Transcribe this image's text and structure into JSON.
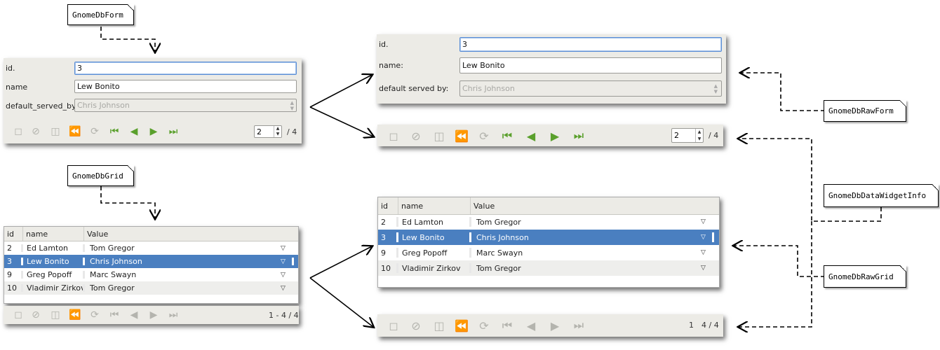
{
  "callouts": {
    "form": "GnomeDbForm",
    "grid": "GnomeDbGrid",
    "raw_form": "GnomeDbRawForm",
    "data_widget_info": "GnomeDbDataWidgetInfo",
    "raw_grid": "GnomeDbRawGrid"
  },
  "small_form": {
    "labels": [
      "id.",
      "name",
      "default_served_by:"
    ],
    "id_value": "3",
    "name_value": "Lew Bonito",
    "served_by_value": "Chris Johnson",
    "spin_value": "2",
    "total": "/ 4"
  },
  "large_form": {
    "labels": [
      "id.",
      "name:",
      "default served by:"
    ],
    "id_value": "3",
    "name_value": "Lew Bonito",
    "served_by_value": "Chris Johnson"
  },
  "large_form_toolbar": {
    "spin_value": "2",
    "total": "/ 4"
  },
  "grid": {
    "columns": [
      "id",
      "name",
      "Value"
    ],
    "rows": [
      {
        "id": "2",
        "name": "Ed Lamton",
        "value": "Tom Gregor",
        "selected": false
      },
      {
        "id": "3",
        "name": "Lew Bonito",
        "value": "Chris Johnson",
        "selected": true
      },
      {
        "id": "9",
        "name": "Greg Popoff",
        "value": "Marc Swayn",
        "selected": false
      },
      {
        "id": "10",
        "name": "Vladimir Zirkov",
        "value": "Tom Gregor",
        "selected": false
      }
    ]
  },
  "small_grid_toolbar": {
    "count": "1 - 4 / 4"
  },
  "large_grid_toolbar": {
    "count_a": "1",
    "count_b": "4 / 4"
  },
  "colors": {
    "selection": "#4a7fc0",
    "navigation_arrows": "#5aa02c",
    "panel_bg": "#ecebe6"
  },
  "toolbar_icons": [
    "new-icon",
    "cancel-icon",
    "delete-icon",
    "save-icon",
    "reset-icon",
    "first-icon",
    "prev-icon",
    "next-icon",
    "last-icon"
  ]
}
